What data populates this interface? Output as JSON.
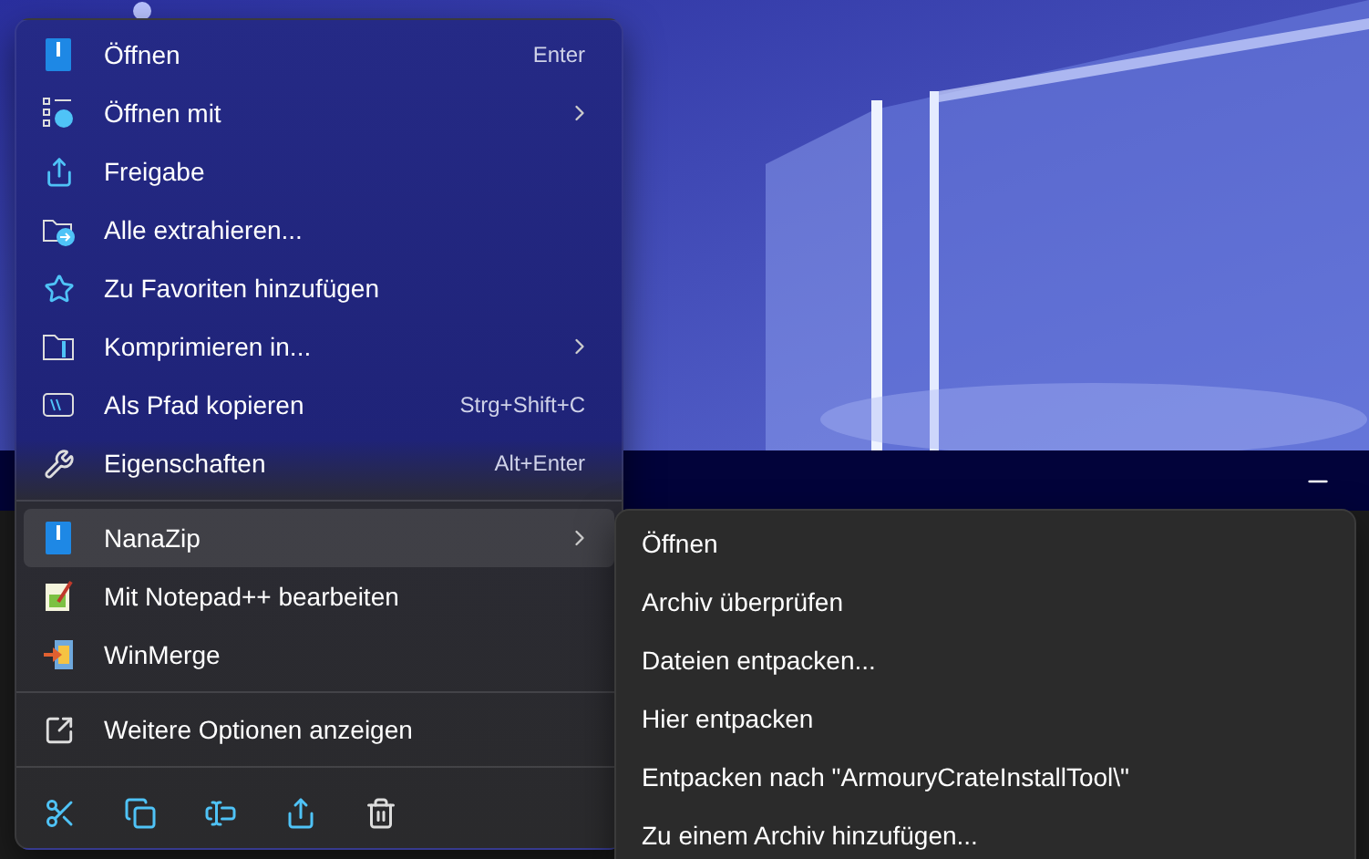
{
  "menu": {
    "items": [
      {
        "kind": "item",
        "label": "Öffnen",
        "shortcut": "Enter",
        "submenu": false,
        "selected": false
      },
      {
        "kind": "item",
        "label": "Öffnen mit",
        "submenu": true,
        "selected": false
      },
      {
        "kind": "item",
        "label": "Freigabe",
        "submenu": false,
        "selected": false
      },
      {
        "kind": "item",
        "label": "Alle extrahieren...",
        "submenu": false,
        "selected": false
      },
      {
        "kind": "item",
        "label": "Zu Favoriten hinzufügen",
        "submenu": false,
        "selected": false
      },
      {
        "kind": "item",
        "label": "Komprimieren in...",
        "submenu": true,
        "selected": false
      },
      {
        "kind": "item",
        "label": "Als Pfad kopieren",
        "shortcut": "Strg+Shift+C",
        "submenu": false,
        "selected": false
      },
      {
        "kind": "item",
        "label": "Eigenschaften",
        "shortcut": "Alt+Enter",
        "submenu": false,
        "selected": false
      },
      {
        "kind": "separator"
      },
      {
        "kind": "item",
        "label": "NanaZip",
        "submenu": true,
        "selected": true
      },
      {
        "kind": "item",
        "label": "Mit Notepad++ bearbeiten",
        "submenu": false,
        "selected": false
      },
      {
        "kind": "item",
        "label": "WinMerge",
        "submenu": false,
        "selected": false
      },
      {
        "kind": "separator"
      },
      {
        "kind": "item",
        "label": "Weitere Optionen anzeigen",
        "submenu": false,
        "selected": false
      },
      {
        "kind": "separator"
      }
    ],
    "toolbar": [
      {
        "kind": "cut"
      },
      {
        "kind": "copy"
      },
      {
        "kind": "rename"
      },
      {
        "kind": "share"
      },
      {
        "kind": "delete"
      }
    ]
  },
  "submenu": {
    "items": [
      {
        "label": "Öffnen"
      },
      {
        "label": "Archiv überprüfen"
      },
      {
        "label": "Dateien entpacken..."
      },
      {
        "label": "Hier entpacken"
      },
      {
        "label": "Entpacken nach \"ArmouryCrateInstallTool\\\""
      },
      {
        "label": "Zu einem Archiv hinzufügen..."
      }
    ]
  }
}
